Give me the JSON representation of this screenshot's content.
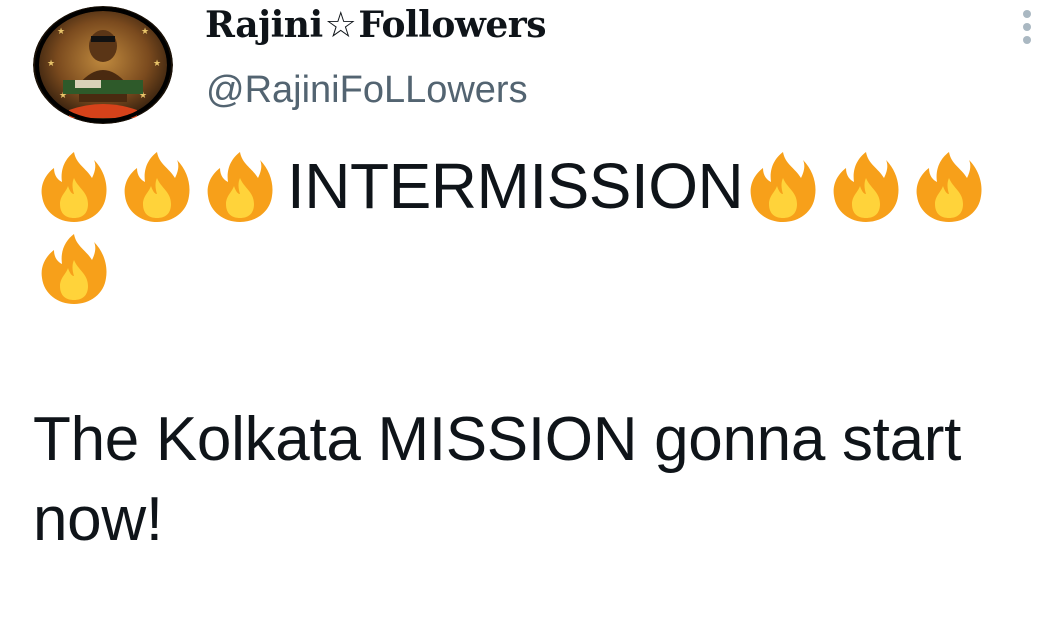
{
  "tweet": {
    "author": {
      "display_name_part1": "Rajini",
      "display_name_star": "☆",
      "display_name_part2": "Followers",
      "handle": "@RajiniFoLLowers",
      "avatar_icon": "profile-photo-avatar"
    },
    "more_icon": "more-vertical-icon",
    "content": {
      "line1_leading_emoji": [
        "fire",
        "fire",
        "fire"
      ],
      "line1_word": "INTERMISSION",
      "line1_trailing_emoji": [
        "fire",
        "fire",
        "fire"
      ],
      "line2_emoji": [
        "fire"
      ],
      "body": "The Kolkata MISSION gonna start now!"
    },
    "colors": {
      "text": "#0f1419",
      "handle": "#536471",
      "more_dots": "#aab8c2",
      "fire_outer": "#f7a01a",
      "fire_inner": "#ffd33a"
    }
  }
}
